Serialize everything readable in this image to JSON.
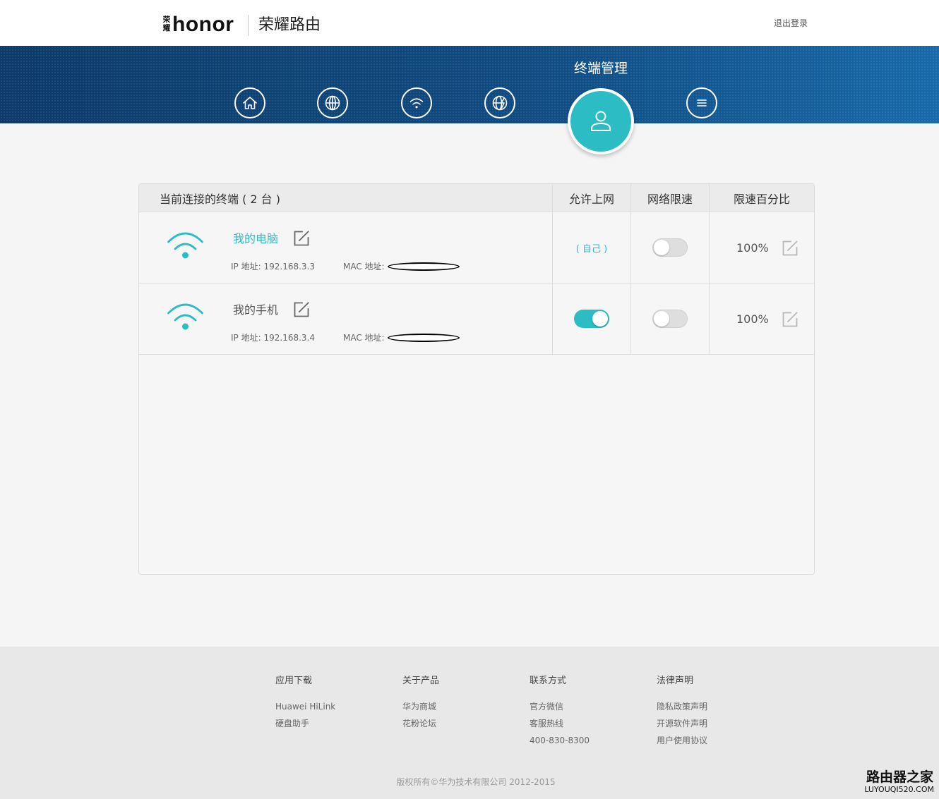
{
  "colors": {
    "accent": "#2bbcc4",
    "banner_left": "#0c3a68",
    "banner_right": "#1769a9",
    "footer_bg": "#e8e8e8",
    "page_bg": "#f5f5f5"
  },
  "header": {
    "logo_small": "荣耀",
    "logo_brand": "honor",
    "product_name": "荣耀路由",
    "logout_label": "退出登录"
  },
  "nav": {
    "active_label": "终端管理",
    "items": [
      {
        "icon": "home-icon",
        "active": false
      },
      {
        "icon": "globe-icon",
        "active": false
      },
      {
        "icon": "wifi-icon",
        "active": false
      },
      {
        "icon": "globe-lightning-icon",
        "active": false
      },
      {
        "icon": "user-icon",
        "active": true
      },
      {
        "icon": "menu-icon",
        "active": false
      }
    ]
  },
  "device_table": {
    "title": "当前连接的终端 ( 2 台 )",
    "columns": {
      "allow_internet": "允许上网",
      "speed_limit": "网络限速",
      "limit_percent": "限速百分比"
    },
    "devices": [
      {
        "icon": "wifi-signal-icon",
        "name": "我的电脑",
        "ip_label": "IP 地址:",
        "ip": "192.168.3.3",
        "mac_label": "MAC 地址:",
        "allow_internet_text": "( 自己 )",
        "speed_limit_enabled": false,
        "limit_percent": "100%"
      },
      {
        "icon": "wifi-signal-icon",
        "name": "我的手机",
        "ip_label": "IP 地址:",
        "ip": "192.168.3.4",
        "mac_label": "MAC 地址:",
        "allow_internet": true,
        "speed_limit_enabled": false,
        "limit_percent": "100%"
      }
    ]
  },
  "footer": {
    "columns": [
      {
        "title": "应用下载",
        "links": [
          "Huawei HiLink",
          "硬盘助手"
        ]
      },
      {
        "title": "关于产品",
        "links": [
          "华为商城",
          "花粉论坛"
        ]
      },
      {
        "title": "联系方式",
        "links": [
          "官方微信",
          "客服热线",
          "400-830-8300"
        ]
      },
      {
        "title": "法律声明",
        "links": [
          "隐私政策声明",
          "开源软件声明",
          "用户使用协议"
        ]
      }
    ],
    "copyright": "版权所有©华为技术有限公司 2012-2015"
  },
  "watermark": {
    "name": "路由器之家",
    "site": "LUYOUQI520.COM"
  }
}
